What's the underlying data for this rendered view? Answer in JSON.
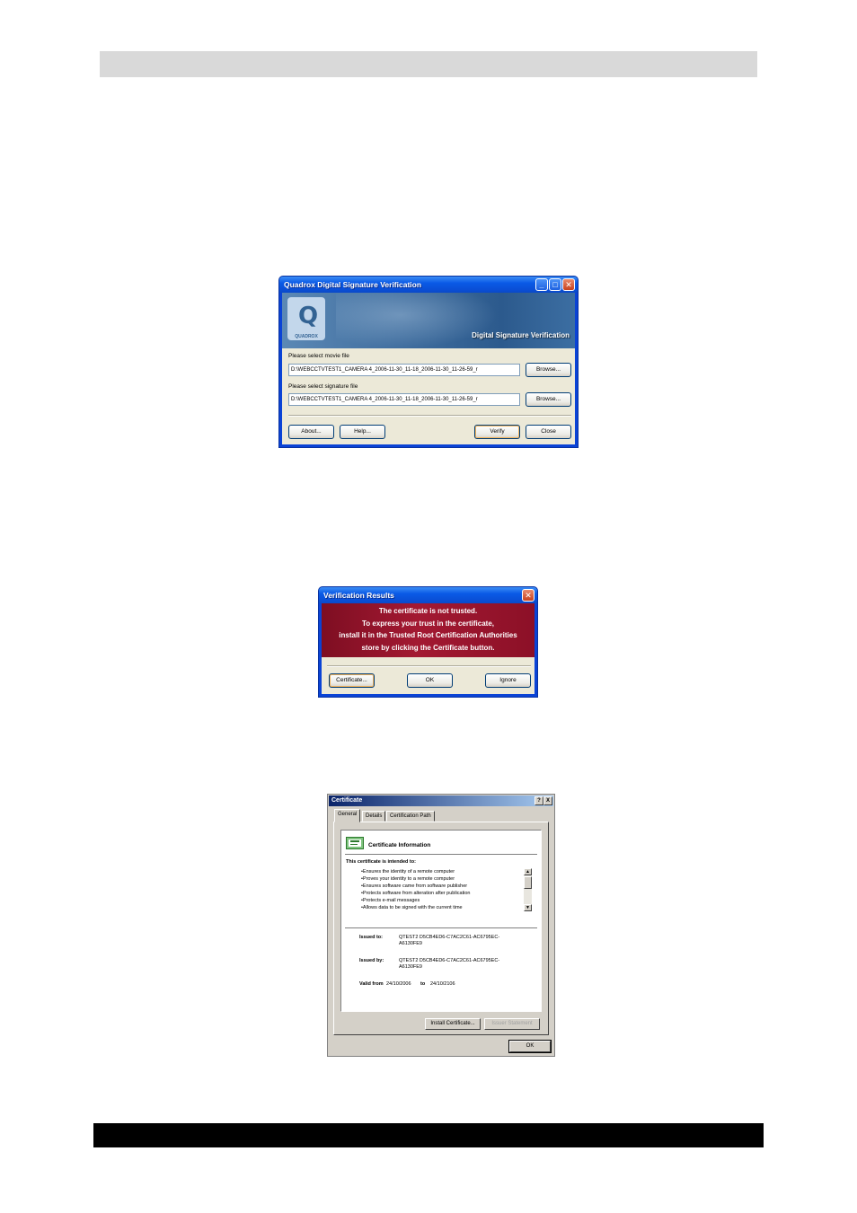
{
  "signature_dialog": {
    "title": "Quadrox Digital Signature Verification",
    "window_buttons": {
      "minimize": "_",
      "maximize": "□",
      "close": "✕"
    },
    "banner": {
      "logo_text": "QUADROX",
      "logo_letter": "Q",
      "title": "Digital Signature Verification"
    },
    "movie_label": "Please select movie file",
    "movie_path": "D:\\WEBCCTVTEST1_CAMERA 4_2006-11-30_11-18_2006-11-30_11-26-59_r",
    "signature_label": "Please select signature file",
    "signature_path": "D:\\WEBCCTVTEST1_CAMERA 4_2006-11-30_11-18_2006-11-30_11-26-59_r",
    "browse_label": "Browse...",
    "about_label": "About...",
    "help_label": "Help...",
    "verify_label": "Verify",
    "close_label": "Close"
  },
  "results_dialog": {
    "title": "Verification Results",
    "close_glyph": "✕",
    "messages": [
      "The certificate is not trusted.",
      "To express your trust in the certificate,",
      "install it in the Trusted Root Certification Authorities",
      "store by clicking the Certificate button."
    ],
    "certificate_label": "Certificate...",
    "ok_label": "OK",
    "ignore_label": "Ignore"
  },
  "certificate_dialog": {
    "title": "Certificate",
    "title_buttons": {
      "help": "?",
      "close": "X"
    },
    "tabs": [
      "General",
      "Details",
      "Certification Path"
    ],
    "info_title": "Certificate Information",
    "intended_heading": "This certificate is intended to:",
    "purposes": [
      "•Ensures the identity of a remote computer",
      "•Proves your identity to a remote computer",
      "•Ensures software came from software publisher",
      "•Protects software from alteration after publication",
      "•Protects e-mail messages",
      "•Allows data to be signed with the current time"
    ],
    "issued_to_label": "Issued to:",
    "issued_to_value_1": "QTEST2 D5CB4ED6-C7AC2C61-AC6795EC-",
    "issued_to_value_2": "A6130FE9",
    "issued_by_label": "Issued by:",
    "issued_by_value_1": "QTEST2 D5CB4ED6-C7AC2C61-AC6795EC-",
    "issued_by_value_2": "A6130FE9",
    "valid_from_label": "Valid from",
    "valid_from": "24/10/2006",
    "valid_to_word": "to",
    "valid_to": "24/10/2106",
    "install_label": "Install Certificate...",
    "issuer_statement_label": "Issuer Statement",
    "ok_label": "OK"
  }
}
